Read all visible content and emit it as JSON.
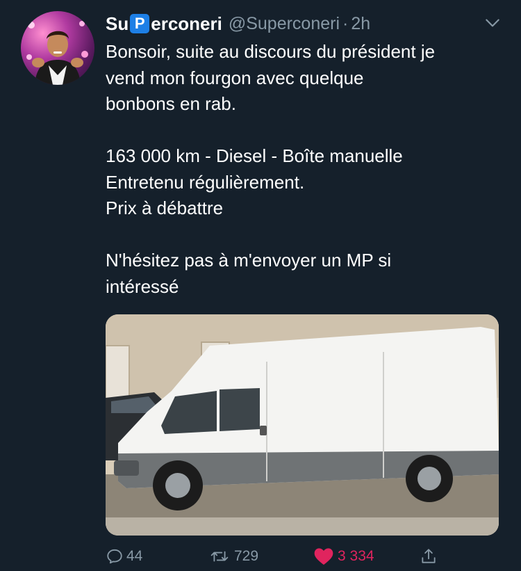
{
  "tweet": {
    "name_prefix": "Su",
    "name_badge": "P",
    "name_suffix": "erconeri",
    "handle": "@Superconeri",
    "separator": "·",
    "time": "2h",
    "text": "Bonsoir, suite au discours du président je\nvend mon fourgon avec quelque\nbonbons en rab.\n\n163 000 km - Diesel - Boîte manuelle\nEntretenu régulièrement.\nPrix à débattre\n\nN'hésitez pas à m'envoyer un MP si\nintéressé",
    "media_icon": "white-van-photo",
    "actions": {
      "reply_icon": "reply-icon",
      "reply_count": "44",
      "retweet_icon": "retweet-icon",
      "retweet_count": "729",
      "like_icon": "heart-icon",
      "like_count": "3 334",
      "share_icon": "share-icon"
    }
  },
  "colors": {
    "background": "#15202b",
    "secondary_text": "#8899a6",
    "like": "#e0245e",
    "badge": "#1d7fe6"
  }
}
